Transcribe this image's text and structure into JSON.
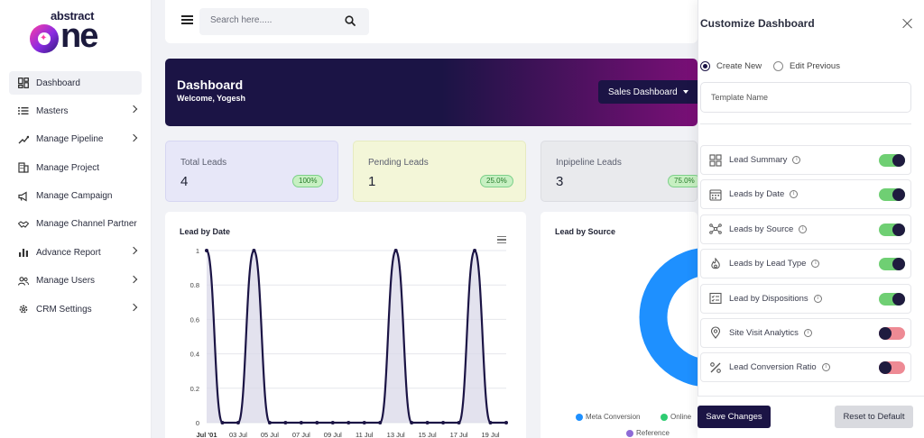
{
  "brand": {
    "small": "abstract",
    "big": "one"
  },
  "sidebar": {
    "items": [
      {
        "label": "Dashboard",
        "icon": "dashboard-grid-icon",
        "active": true,
        "chevron": false
      },
      {
        "label": "Masters",
        "icon": "list-icon",
        "active": false,
        "chevron": true
      },
      {
        "label": "Manage Pipeline",
        "icon": "pipeline-icon",
        "active": false,
        "chevron": true
      },
      {
        "label": "Manage Project",
        "icon": "building-icon",
        "active": false,
        "chevron": false
      },
      {
        "label": "Manage Campaign",
        "icon": "megaphone-icon",
        "active": false,
        "chevron": false
      },
      {
        "label": "Manage Channel Partner",
        "icon": "handshake-icon",
        "active": false,
        "chevron": false
      },
      {
        "label": "Advance Report",
        "icon": "bar-chart-icon",
        "active": false,
        "chevron": true
      },
      {
        "label": "Manage Users",
        "icon": "users-icon",
        "active": false,
        "chevron": true
      },
      {
        "label": "CRM Settings",
        "icon": "gear-icon",
        "active": false,
        "chevron": true
      }
    ]
  },
  "search": {
    "placeholder": "Search here....."
  },
  "banner": {
    "title": "Dashboard",
    "subtitle": "Welcome, Yogesh",
    "dropdown": "Sales Dashboard"
  },
  "stats": [
    {
      "label": "Total Leads",
      "value": "4",
      "badge": "100%"
    },
    {
      "label": "Pending Leads",
      "value": "1",
      "badge": "25.0%"
    },
    {
      "label": "Inpipeline Leads",
      "value": "3",
      "badge": "75.0%"
    }
  ],
  "panels": {
    "lead_by_date": "Lead by Date",
    "lead_by_source": "Lead by Source"
  },
  "chart_data": [
    {
      "type": "area",
      "title": "Lead by Date",
      "x": [
        "Jul '01",
        "",
        "03 Jul",
        "",
        "05 Jul",
        "",
        "07 Jul",
        "",
        "09 Jul",
        "",
        "11 Jul",
        "",
        "13 Jul",
        "",
        "15 Jul",
        "",
        "17 Jul",
        "",
        "19 Jul",
        ""
      ],
      "values": [
        1,
        0,
        0,
        1,
        0,
        0,
        0,
        0,
        0,
        0,
        0,
        0,
        1,
        0,
        0,
        0,
        0,
        1,
        0,
        0
      ],
      "ylim": [
        0,
        1
      ],
      "yticks": [
        "0",
        "0.2",
        "0.4",
        "0.6",
        "0.8",
        "1"
      ],
      "color": "#1b1445"
    },
    {
      "type": "pie",
      "title": "Lead by Source",
      "legend": [
        {
          "name": "Meta Conversion",
          "color": "#1e90ff"
        },
        {
          "name": "Online",
          "color": "#2ecc71"
        },
        {
          "name": "Reference",
          "color": "#8e6bd6"
        }
      ]
    }
  ],
  "overlay": {
    "title": "Customize Dashboard",
    "radio_create": "Create New",
    "radio_edit": "Edit Previous",
    "template_placeholder": "Template Name",
    "widgets": [
      {
        "label": "Lead Summary",
        "icon": "grid-icon",
        "enabled": true
      },
      {
        "label": "Leads by Date",
        "icon": "calendar-icon",
        "enabled": true
      },
      {
        "label": "Leads by Source",
        "icon": "network-icon",
        "enabled": true
      },
      {
        "label": "Leads by Lead Type",
        "icon": "flame-icon",
        "enabled": true
      },
      {
        "label": "Lead by Dispositions",
        "icon": "checklist-icon",
        "enabled": true
      },
      {
        "label": "Site Visit Analytics",
        "icon": "location-pin-icon",
        "enabled": false
      },
      {
        "label": "Lead Conversion Ratio",
        "icon": "percent-icon",
        "enabled": false
      }
    ],
    "save_label": "Save Changes",
    "reset_label": "Reset to Default"
  }
}
